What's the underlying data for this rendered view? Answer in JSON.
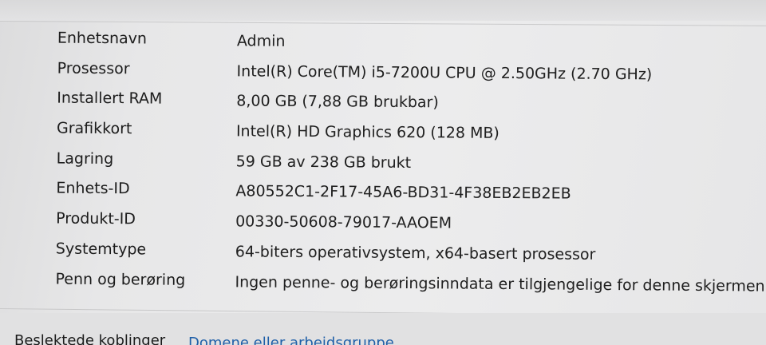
{
  "specs": [
    {
      "label": "Enhetsnavn",
      "value": "Admin"
    },
    {
      "label": "Prosessor",
      "value": "Intel(R) Core(TM) i5-7200U CPU @ 2.50GHz (2.70 GHz)"
    },
    {
      "label": "Installert RAM",
      "value": "8,00 GB (7,88 GB brukbar)"
    },
    {
      "label": "Grafikkort",
      "value": "Intel(R) HD Graphics 620 (128 MB)"
    },
    {
      "label": "Lagring",
      "value": "59 GB av 238 GB brukt"
    },
    {
      "label": "Enhets-ID",
      "value": "A80552C1-2F17-45A6-BD31-4F38EB2EB2EB"
    },
    {
      "label": "Produkt-ID",
      "value": "00330-50608-79017-AAOEM"
    },
    {
      "label": "Systemtype",
      "value": "64-biters operativsystem, x64-basert prosessor"
    },
    {
      "label": "Penn og berøring",
      "value": "Ingen penne- og berøringsinndata er tilgjengelige for denne skjermen"
    }
  ],
  "related": {
    "label": "Beslektede koblinger",
    "link": "Domene eller arbeidsgruppe"
  },
  "colors": {
    "background": "#e9e9ea",
    "text": "#1c1c1c",
    "link": "#1f5fa8"
  }
}
